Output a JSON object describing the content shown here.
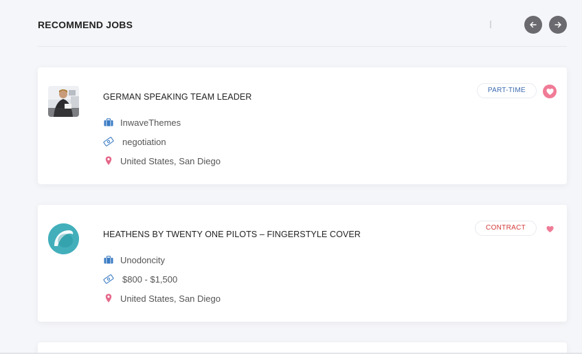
{
  "section": {
    "title": "RECOMMEND JOBS"
  },
  "colors": {
    "page_bg": "#f5f6f9",
    "nav_button": "#6b6b6f",
    "part_time": "#3b6ab0",
    "contract": "#d43a3a",
    "favorite": "#f07b96",
    "briefcase_icon": "#3a7bc4",
    "location_icon": "#e5688a"
  },
  "jobs": [
    {
      "title": "GERMAN SPEAKING TEAM LEADER",
      "company": "InwaveThemes",
      "salary": "negotiation",
      "location": "United States, San Diego",
      "type": "PART-TIME",
      "favorited": true,
      "logo": "photo-person-at-desk"
    },
    {
      "title": "HEATHENS BY TWENTY ONE PILOTS – FINGERSTYLE COVER",
      "company": "Unodoncity",
      "salary": "$800 - $1,500",
      "location": "United States, San Diego",
      "type": "CONTRACT",
      "favorited": false,
      "logo": "teal-circle-logo"
    }
  ]
}
